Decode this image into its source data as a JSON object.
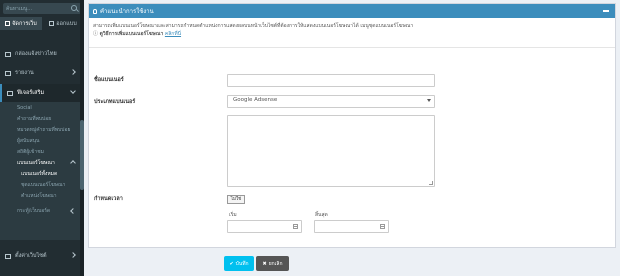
{
  "sidebar": {
    "search_placeholder": "ค้นหาเมนู...",
    "tabs": [
      {
        "label": "จัดการเว็บ"
      },
      {
        "label": "ออกแบบ"
      }
    ],
    "items": [
      {
        "label": "กล่องแจ้งข่าวไทย",
        "icon": "home-icon"
      },
      {
        "label": "รายงาน",
        "icon": "chart-icon"
      },
      {
        "label": "ฟีเจอร์เสริม",
        "icon": "puzzle-icon"
      }
    ],
    "sub_items": [
      {
        "label": "Social"
      },
      {
        "label": "คำถามที่พบบ่อย"
      },
      {
        "label": "หมวดหมู่คำถามที่พบบ่อย"
      },
      {
        "label": "ผู้สนับสนุน"
      },
      {
        "label": "สถิติผู้เข้าชม"
      },
      {
        "label": "แบนเนอร์โฆษณา"
      },
      {
        "label": "แบนเนอร์ทั้งหมด"
      },
      {
        "label": "ชุดแบนเนอร์โฆษณา"
      },
      {
        "label": "ตำแหน่งโฆษณา"
      },
      {
        "label": "กระทู้/เว็บบอร์ด"
      }
    ],
    "settings_label": "ตั้งค่าเว็บไซต์"
  },
  "panel": {
    "title": "คำแนะนำการใช้งาน",
    "info_line1": "สามารถเพิ่มแบนเนอร์โฆษณาและสามารถกำหนดตำแหน่งการแสดงผลบนหน้าเว็บไซต์ที่ต้องการให้แสดงแบนเนอร์โฆษณาได้ เมนูชุดแบนเนอร์โฆษณา",
    "info_line2": "ดูวิธีการเพิ่มแบนเนอร์โฆษณา",
    "info_link": "คลิกที่นี่"
  },
  "form": {
    "name_label": "ชื่อแบนเนอร์",
    "type_label": "ประเภทแบนเนอร์",
    "type_value": "Google Adsense",
    "period_label": "กำหนดเวลา",
    "toggle_label": "ไม่ใช่",
    "start_label": "เริ่ม",
    "end_label": "สิ้นสุด"
  },
  "buttons": {
    "save": "บันทึก",
    "cancel": "ยกเลิก"
  }
}
